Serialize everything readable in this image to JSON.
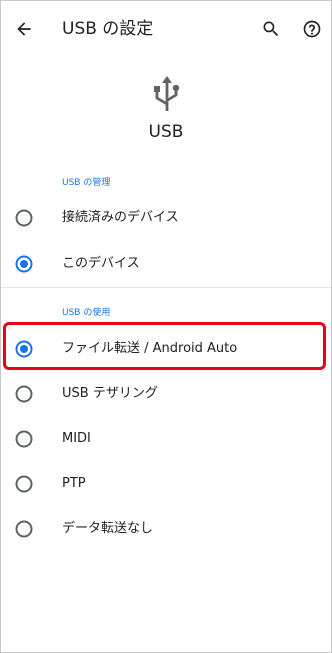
{
  "appbar": {
    "title": "USB の設定",
    "back_icon": "arrow-back-icon",
    "search_icon": "search-icon",
    "help_icon": "help-icon"
  },
  "header": {
    "icon": "usb-icon",
    "title": "USB"
  },
  "sections": [
    {
      "header": "USB の管理",
      "options": [
        {
          "label": "接続済みのデバイス",
          "selected": false
        },
        {
          "label": "このデバイス",
          "selected": true
        }
      ]
    },
    {
      "header": "USB の使用",
      "options": [
        {
          "label": "ファイル転送 / Android Auto",
          "selected": true
        },
        {
          "label": "USB テザリング",
          "selected": false
        },
        {
          "label": "MIDI",
          "selected": false
        },
        {
          "label": "PTP",
          "selected": false
        },
        {
          "label": "データ転送なし",
          "selected": false
        }
      ]
    }
  ],
  "colors": {
    "accent": "#1a73e8",
    "radio_unselected": "#5f6368",
    "highlight": "#e8001c"
  }
}
